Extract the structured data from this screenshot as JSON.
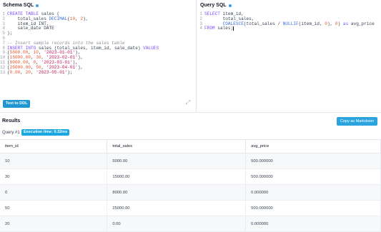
{
  "schema": {
    "title": "Schema SQL",
    "lines": [
      {
        "n": "1",
        "parts": [
          {
            "t": "CREATE TABLE ",
            "c": "kw"
          },
          {
            "t": "sales (",
            "c": "txt"
          }
        ]
      },
      {
        "n": "2",
        "parts": [
          {
            "t": "    total_sales ",
            "c": "txt"
          },
          {
            "t": "DECIMAL",
            "c": "fn"
          },
          {
            "t": "(",
            "c": "txt"
          },
          {
            "t": "10",
            "c": "num"
          },
          {
            "t": ", ",
            "c": "txt"
          },
          {
            "t": "2",
            "c": "num"
          },
          {
            "t": "),",
            "c": "txt"
          }
        ]
      },
      {
        "n": "3",
        "parts": [
          {
            "t": "    item_id INT,",
            "c": "txt"
          }
        ]
      },
      {
        "n": "4",
        "parts": [
          {
            "t": "    sale_date DATE",
            "c": "txt"
          }
        ]
      },
      {
        "n": "5",
        "parts": [
          {
            "t": ");",
            "c": "txt"
          }
        ]
      },
      {
        "n": "6",
        "parts": []
      },
      {
        "n": "7",
        "parts": [
          {
            "t": "-- Insert sample records into the sales table",
            "c": "com"
          }
        ]
      },
      {
        "n": "8",
        "parts": [
          {
            "t": "INSERT INTO ",
            "c": "kw"
          },
          {
            "t": "sales (total_sales, item_id, sale_date) ",
            "c": "txt"
          },
          {
            "t": "VALUES",
            "c": "kw"
          }
        ]
      },
      {
        "n": "9",
        "parts": [
          {
            "t": "(",
            "c": "txt"
          },
          {
            "t": "5000.00",
            "c": "num"
          },
          {
            "t": ", ",
            "c": "txt"
          },
          {
            "t": "10",
            "c": "num"
          },
          {
            "t": ", ",
            "c": "txt"
          },
          {
            "t": "'2023-01-01'",
            "c": "str"
          },
          {
            "t": "),",
            "c": "txt"
          }
        ]
      },
      {
        "n": "10",
        "parts": [
          {
            "t": "(",
            "c": "txt"
          },
          {
            "t": "15000.00",
            "c": "num"
          },
          {
            "t": ", ",
            "c": "txt"
          },
          {
            "t": "30",
            "c": "num"
          },
          {
            "t": ", ",
            "c": "txt"
          },
          {
            "t": "'2023-02-01'",
            "c": "str"
          },
          {
            "t": "),",
            "c": "txt"
          }
        ]
      },
      {
        "n": "11",
        "parts": [
          {
            "t": "(",
            "c": "txt"
          },
          {
            "t": "8000.00",
            "c": "num"
          },
          {
            "t": ", ",
            "c": "txt"
          },
          {
            "t": "0",
            "c": "num"
          },
          {
            "t": ", ",
            "c": "txt"
          },
          {
            "t": "'2023-03-01'",
            "c": "str"
          },
          {
            "t": "),",
            "c": "txt"
          }
        ]
      },
      {
        "n": "12",
        "parts": [
          {
            "t": "(",
            "c": "txt"
          },
          {
            "t": "25000.00",
            "c": "num"
          },
          {
            "t": ", ",
            "c": "txt"
          },
          {
            "t": "50",
            "c": "num"
          },
          {
            "t": ", ",
            "c": "txt"
          },
          {
            "t": "'2023-04-01'",
            "c": "str"
          },
          {
            "t": "),",
            "c": "txt"
          }
        ]
      },
      {
        "n": "13",
        "parts": [
          {
            "t": "(",
            "c": "txt"
          },
          {
            "t": "0.00",
            "c": "num"
          },
          {
            "t": ", ",
            "c": "txt"
          },
          {
            "t": "20",
            "c": "num"
          },
          {
            "t": ", ",
            "c": "txt"
          },
          {
            "t": "'2023-05-01'",
            "c": "str"
          },
          {
            "t": ");",
            "c": "txt"
          }
        ]
      }
    ],
    "button_label": "Text to DDL",
    "expand_icon": "expand-icon"
  },
  "query": {
    "title": "Query SQL",
    "lines": [
      {
        "n": "1",
        "parts": [
          {
            "t": "SELECT ",
            "c": "kw"
          },
          {
            "t": "item_id,",
            "c": "txt"
          }
        ]
      },
      {
        "n": "2",
        "parts": [
          {
            "t": "       total_sales,",
            "c": "txt"
          }
        ]
      },
      {
        "n": "3",
        "parts": [
          {
            "t": "       ",
            "c": "txt"
          },
          {
            "t": "COALESCE",
            "c": "fn"
          },
          {
            "t": "(total_sales / ",
            "c": "txt"
          },
          {
            "t": "NULLIF",
            "c": "fn"
          },
          {
            "t": "(item_id, ",
            "c": "txt"
          },
          {
            "t": "0",
            "c": "num"
          },
          {
            "t": "), ",
            "c": "txt"
          },
          {
            "t": "0",
            "c": "num"
          },
          {
            "t": ") ",
            "c": "txt"
          },
          {
            "t": "as ",
            "c": "kw"
          },
          {
            "t": "avg_price",
            "c": "txt"
          }
        ]
      },
      {
        "n": "4",
        "parts": [
          {
            "t": "FROM ",
            "c": "kw"
          },
          {
            "t": "sales;",
            "c": "txt"
          }
        ],
        "cursor": true
      }
    ]
  },
  "results": {
    "title": "Results",
    "copy_label": "Copy as Markdown",
    "query_label": "Query #1",
    "execution_time": "Execution time: 0.32ms",
    "columns": [
      "item_id",
      "total_sales",
      "avg_price"
    ],
    "rows": [
      [
        "10",
        "5000.00",
        "500.000000"
      ],
      [
        "30",
        "15000.00",
        "500.000000"
      ],
      [
        "0",
        "8000.00",
        "0.000000"
      ],
      [
        "50",
        "25000.00",
        "500.000000"
      ],
      [
        "20",
        "0.00",
        "0.000000"
      ]
    ]
  }
}
